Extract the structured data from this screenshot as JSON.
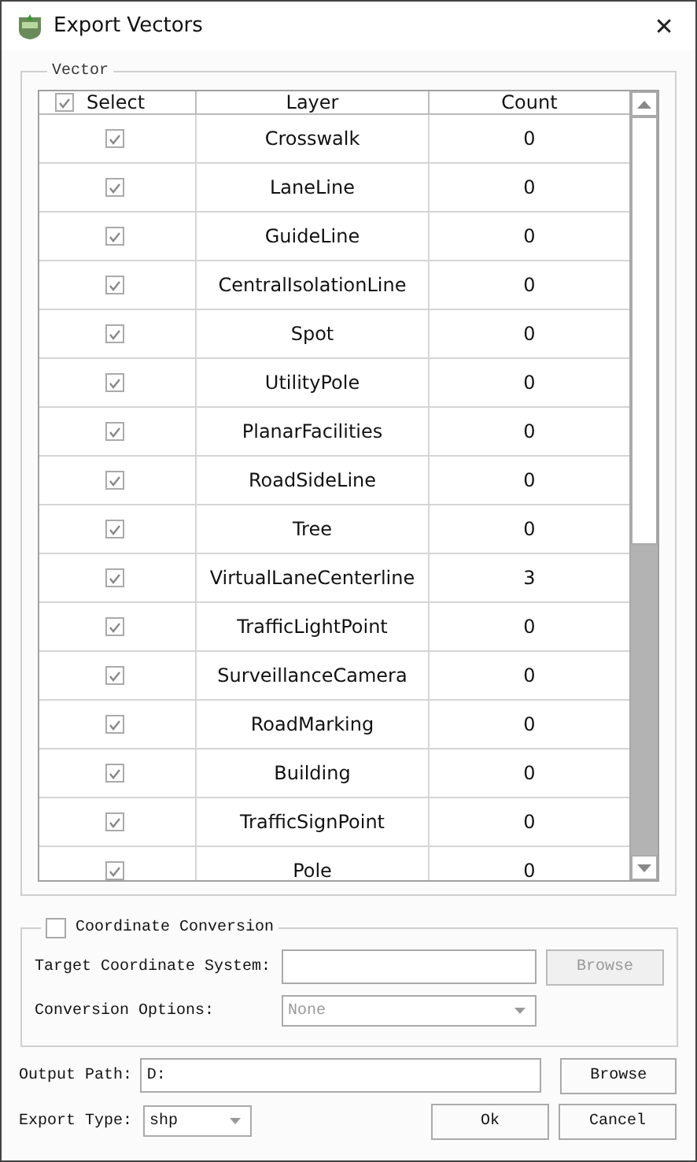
{
  "window": {
    "title": "Export Vectors",
    "close": "✕"
  },
  "vector": {
    "title": "Vector",
    "columns": [
      {
        "label": "Select",
        "checked": true
      },
      {
        "label": "Layer"
      },
      {
        "label": "Count"
      }
    ],
    "rows": [
      {
        "checked": true,
        "layer": "Crosswalk",
        "count": "0"
      },
      {
        "checked": true,
        "layer": "LaneLine",
        "count": "0"
      },
      {
        "checked": true,
        "layer": "GuideLine",
        "count": "0"
      },
      {
        "checked": true,
        "layer": "CentralIsolationLine",
        "count": "0"
      },
      {
        "checked": true,
        "layer": "Spot",
        "count": "0"
      },
      {
        "checked": true,
        "layer": "UtilityPole",
        "count": "0"
      },
      {
        "checked": true,
        "layer": "PlanarFacilities",
        "count": "0"
      },
      {
        "checked": true,
        "layer": "RoadSideLine",
        "count": "0"
      },
      {
        "checked": true,
        "layer": "Tree",
        "count": "0"
      },
      {
        "checked": true,
        "layer": "VirtualLaneCenterline",
        "count": "3"
      },
      {
        "checked": true,
        "layer": "TrafficLightPoint",
        "count": "0"
      },
      {
        "checked": true,
        "layer": "SurveillanceCamera",
        "count": "0"
      },
      {
        "checked": true,
        "layer": "RoadMarking",
        "count": "0"
      },
      {
        "checked": true,
        "layer": "Building",
        "count": "0"
      },
      {
        "checked": true,
        "layer": "TrafficSignPoint",
        "count": "0"
      },
      {
        "checked": true,
        "layer": "Pole",
        "count": "0"
      }
    ]
  },
  "coordinate": {
    "title": "Coordinate Conversion",
    "checked": false,
    "target_label": "Target Coordinate System:",
    "target_browse": {
      "label": "Browse",
      "disabled": true
    },
    "options_label": "Conversion Options:",
    "options": {
      "value": "None",
      "disabled": true
    }
  },
  "output": {
    "label": "Output Path:",
    "value": "D:",
    "browse": "Browse"
  },
  "export_type": {
    "label": "Export Type:",
    "value": "shp"
  },
  "buttons": [
    "Ok",
    "Cancel"
  ]
}
